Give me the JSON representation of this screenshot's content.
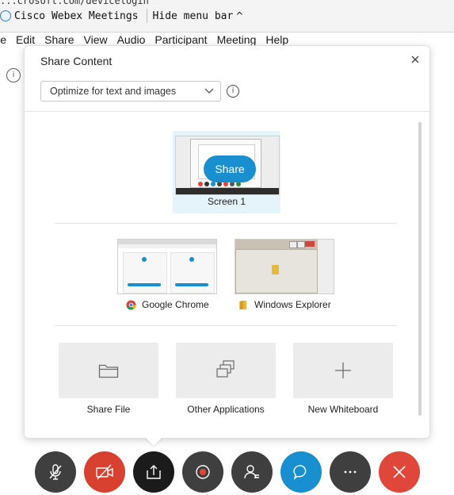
{
  "titlebar": {
    "clip_text": "...crosoft.com/devicelogin",
    "app_title": "Cisco Webex Meetings",
    "hide_menu_label": "Hide menu bar"
  },
  "menu": [
    "ile",
    "Edit",
    "Share",
    "View",
    "Audio",
    "Participant",
    "Meeting",
    "Help"
  ],
  "panel": {
    "title": "Share Content",
    "optimize_select": "Optimize for text and images",
    "screen": {
      "share_button": "Share",
      "label": "Screen 1"
    },
    "apps": [
      {
        "label": "Google Chrome",
        "icon": "chrome-icon"
      },
      {
        "label": "Windows Explorer",
        "icon": "folder-icon"
      }
    ],
    "tools": [
      {
        "label": "Share File",
        "icon": "folder-outline-icon"
      },
      {
        "label": "Other Applications",
        "icon": "stacked-windows-icon"
      },
      {
        "label": "New Whiteboard",
        "icon": "plus-icon"
      }
    ]
  },
  "controls": [
    {
      "name": "mute",
      "icon": "microphone-muted-icon",
      "color": "#3f3f3f"
    },
    {
      "name": "video",
      "icon": "camera-off-icon",
      "color": "#d8412f"
    },
    {
      "name": "share",
      "icon": "share-upload-icon",
      "color": "#1b1b1b"
    },
    {
      "name": "record",
      "icon": "record-icon",
      "color": "#3f3f3f"
    },
    {
      "name": "participants",
      "icon": "participants-icon",
      "color": "#3f3f3f"
    },
    {
      "name": "chat",
      "icon": "chat-icon",
      "color": "#1a8fd0"
    },
    {
      "name": "more",
      "icon": "more-icon",
      "color": "#3f3f3f"
    },
    {
      "name": "leave",
      "icon": "close-icon",
      "color": "#e0463a"
    }
  ],
  "colors": {
    "accent": "#1a8fd0",
    "danger": "#e0463a",
    "selected_tile": "#e5f3fb"
  }
}
